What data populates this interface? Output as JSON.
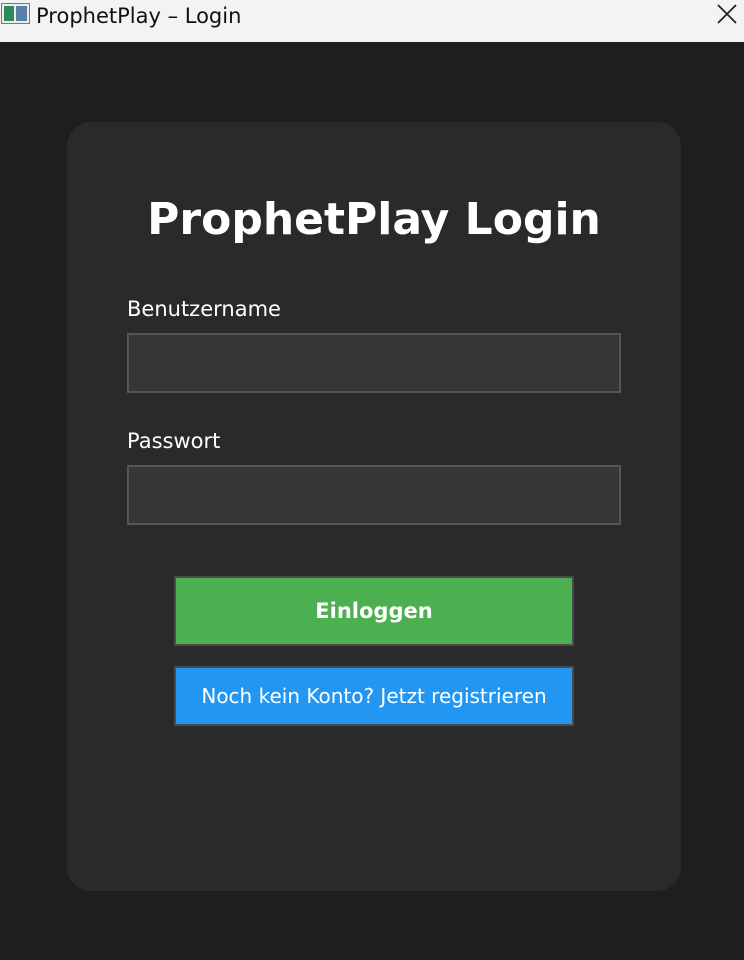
{
  "window": {
    "title": "ProphetPlay – Login",
    "icon": "app-window-icon",
    "close_icon": "close-icon"
  },
  "login": {
    "heading": "ProphetPlay Login",
    "username_label": "Benutzername",
    "username_value": "",
    "password_label": "Passwort",
    "password_value": "",
    "login_button": "Einloggen",
    "register_button": "Noch kein Konto? Jetzt registrieren"
  },
  "colors": {
    "background": "#1e1e1e",
    "card": "#2a2a2a",
    "input_bg": "#363636",
    "login_button": "#4caf50",
    "register_button": "#2196f3",
    "text": "#ffffff"
  }
}
